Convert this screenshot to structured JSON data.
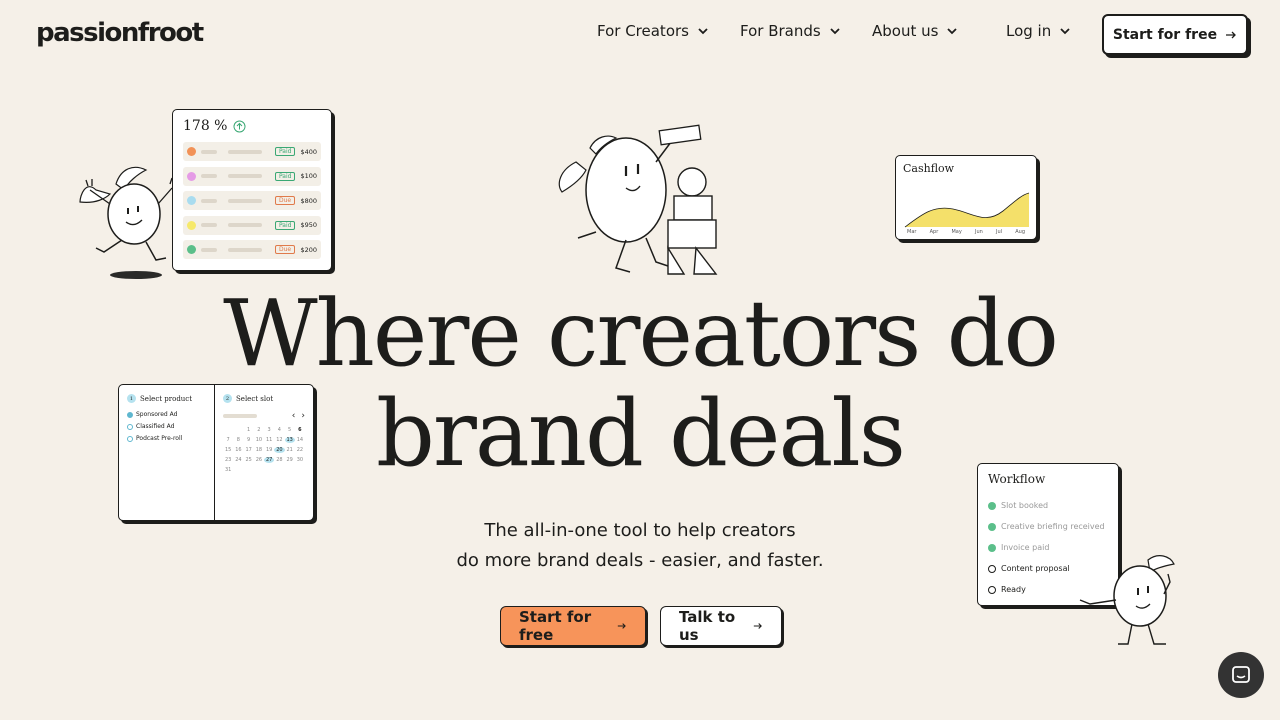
{
  "nav": {
    "logo": "passionfroot",
    "items": [
      "For Creators",
      "For Brands",
      "About us",
      "Log in"
    ],
    "cta": "Start for free"
  },
  "hero": {
    "headline_line1": "Where creators do",
    "headline_line2": "brand deals",
    "sub_line1": "The all-in-one tool to help creators",
    "sub_line2": "do more brand deals - easier, and faster.",
    "cta_primary": "Start for free",
    "cta_secondary": "Talk to us"
  },
  "payments_card": {
    "value": "178 %",
    "rows": [
      {
        "color": "#f29257",
        "status": "Paid",
        "amount": "$400"
      },
      {
        "color": "#e59be6",
        "status": "Paid",
        "amount": "$100"
      },
      {
        "color": "#a9dcef",
        "status": "Due",
        "amount": "$800"
      },
      {
        "color": "#f6e96b",
        "status": "Paid",
        "amount": "$950"
      },
      {
        "color": "#5bbf8a",
        "status": "Due",
        "amount": "$200"
      }
    ]
  },
  "cashflow_card": {
    "title": "Cashflow",
    "months": [
      "Mar",
      "Apr",
      "May",
      "Jun",
      "Jul",
      "Aug"
    ]
  },
  "booking_card": {
    "step1_num": "1",
    "step1": "Select product",
    "step2_num": "2",
    "step2": "Select slot",
    "options": [
      "Sponsored Ad",
      "Classified Ad",
      "Podcast Pre-roll"
    ],
    "calendar_days": [
      "1",
      "2",
      "3",
      "4",
      "5",
      "6",
      "7",
      "8",
      "9",
      "10",
      "11",
      "12",
      "13",
      "14",
      "15",
      "16",
      "17",
      "18",
      "19",
      "20",
      "21",
      "22",
      "23",
      "24",
      "25",
      "26",
      "27",
      "28",
      "29",
      "30",
      "31"
    ]
  },
  "workflow_card": {
    "title": "Workflow",
    "steps": [
      {
        "label": "Slot booked",
        "done": true
      },
      {
        "label": "Creative briefing received",
        "done": true
      },
      {
        "label": "Invoice paid",
        "done": true
      },
      {
        "label": "Content proposal",
        "done": false
      },
      {
        "label": "Ready",
        "done": false
      }
    ]
  },
  "icons": [
    "chevron-down-icon",
    "arrow-right-icon",
    "trend-up-icon",
    "chat-icon"
  ],
  "colors": {
    "background": "#f5f0e8",
    "primary_cta": "#f7945a",
    "ink": "#1d1d1b"
  }
}
